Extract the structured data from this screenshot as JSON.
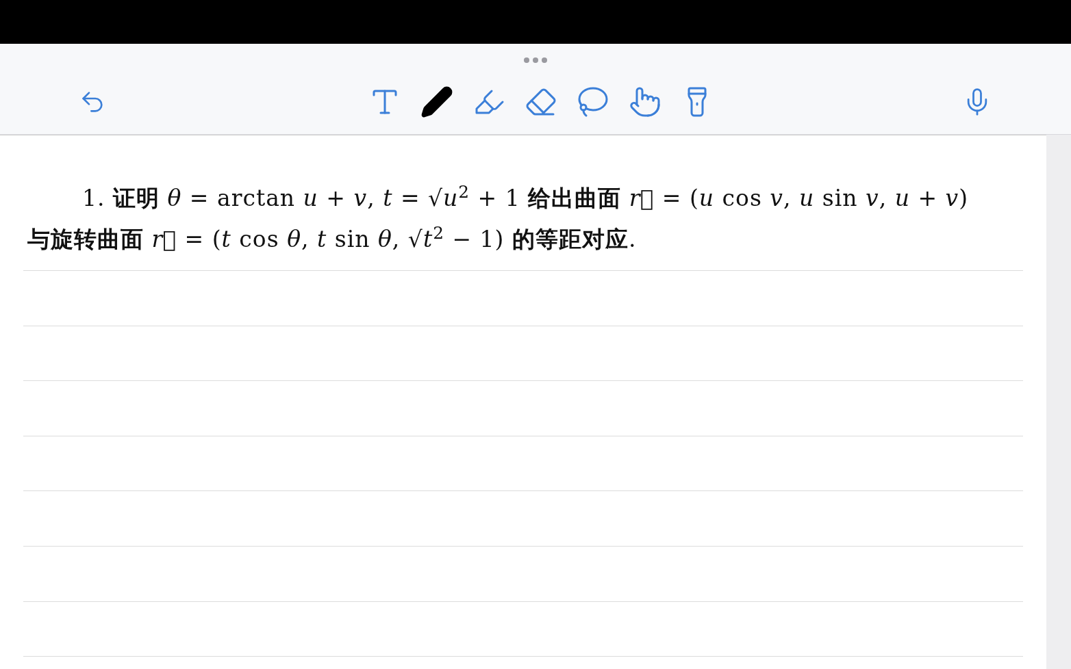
{
  "toolbar": {
    "undo": {
      "disabled": false
    },
    "tools": [
      {
        "kind": "text",
        "selected": false
      },
      {
        "kind": "pen",
        "selected": true
      },
      {
        "kind": "highlighter",
        "selected": false
      },
      {
        "kind": "eraser",
        "selected": false
      },
      {
        "kind": "lasso",
        "selected": false
      },
      {
        "kind": "hand",
        "selected": false
      },
      {
        "kind": "laser",
        "selected": false
      }
    ]
  },
  "note": {
    "problem_lines": [
      "1. **证明** *θ* = arctan *u* + *v*,  *t* = √*u*$^{2}$ + 1 **给出曲面** *r⃗* = (*u* cos *v*, *u* sin *v*, *u* + *v*)",
      "**与旋转曲面** *r⃗* = (*t* cos *θ*, *t* sin *θ*, √*t*$^{2}$ − 1) **的等距对应**."
    ]
  }
}
